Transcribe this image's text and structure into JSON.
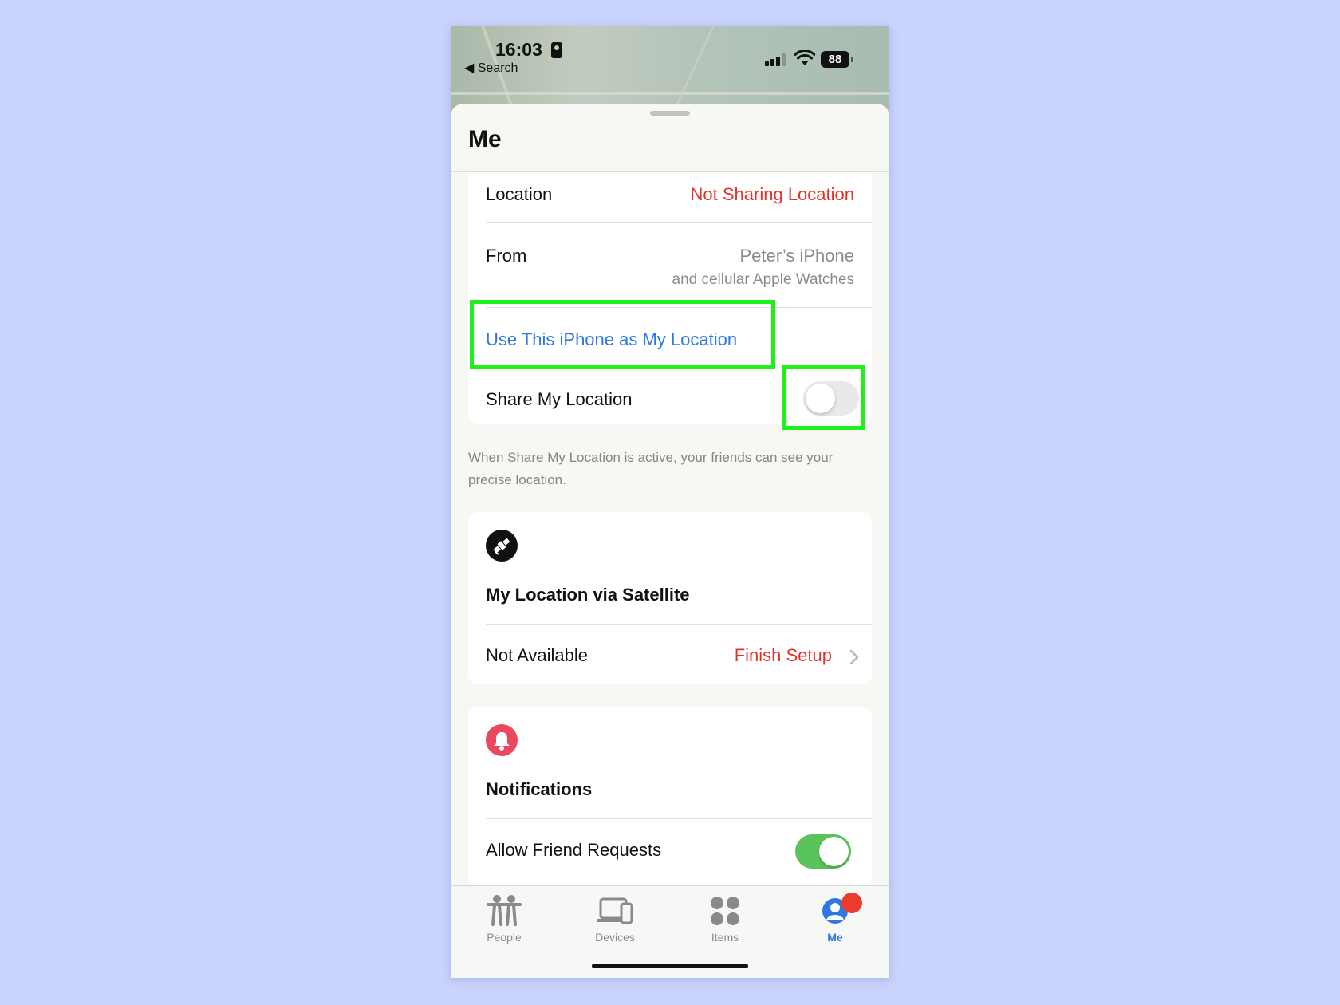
{
  "status_bar": {
    "time": "16:03",
    "back_label": "◀ Search",
    "battery": "88"
  },
  "sheet": {
    "title": "Me"
  },
  "location_card": {
    "location_label": "Location",
    "location_value": "Not Sharing Location",
    "from_label": "From",
    "from_device": "Peter’s iPhone",
    "from_sub": "and cellular Apple Watches",
    "use_iphone_link": "Use This iPhone as My Location",
    "share_label": "Share My Location",
    "share_toggle_on": false
  },
  "footnote": "When Share My Location is active, your friends can see your precise location.",
  "satellite_card": {
    "icon": "satellite-icon",
    "heading": "My Location via Satellite",
    "status_label": "Not Available",
    "action_label": "Finish Setup"
  },
  "notifications_card": {
    "icon": "bell-icon",
    "heading": "Notifications",
    "allow_label": "Allow Friend Requests",
    "allow_toggle_on": true
  },
  "tabs": [
    {
      "label": "People",
      "icon": "people-icon",
      "active": false
    },
    {
      "label": "Devices",
      "icon": "devices-icon",
      "active": false
    },
    {
      "label": "Items",
      "icon": "items-icon",
      "active": false
    },
    {
      "label": "Me",
      "icon": "me-icon",
      "active": true
    }
  ],
  "colors": {
    "accent_blue": "#2f78e4",
    "warning_red": "#e0352b",
    "toggle_green": "#5bc35b",
    "highlight_green": "#1ef01a",
    "background": "#c9d3fb"
  }
}
